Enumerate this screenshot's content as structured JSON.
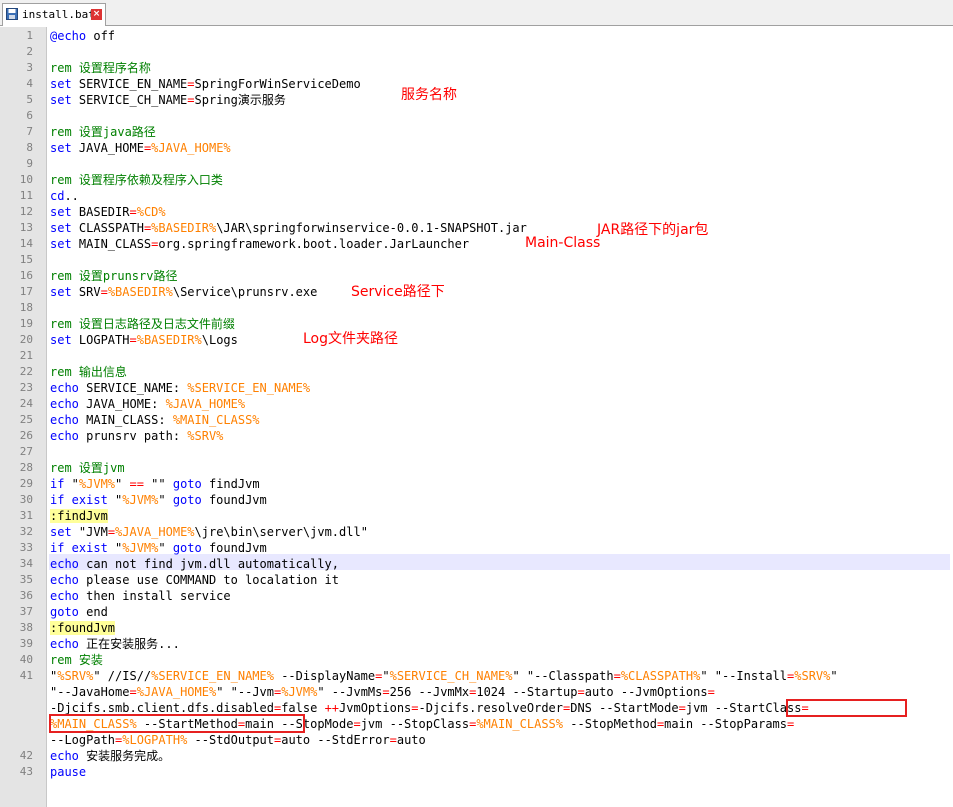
{
  "tab": {
    "filename": "install.bat",
    "close_glyph": "×"
  },
  "lines": [
    {
      "n": "1",
      "parts": [
        [
          "kw",
          "@echo"
        ],
        [
          "t",
          " off"
        ]
      ]
    },
    {
      "n": "2",
      "parts": []
    },
    {
      "n": "3",
      "parts": [
        [
          "cm",
          "rem 设置程序名称"
        ]
      ]
    },
    {
      "n": "4",
      "parts": [
        [
          "kw",
          "set"
        ],
        [
          "t",
          " SERVICE_EN_NAME"
        ],
        [
          "op",
          "="
        ],
        [
          "t",
          "SpringForWinServiceDemo"
        ]
      ]
    },
    {
      "n": "5",
      "parts": [
        [
          "kw",
          "set"
        ],
        [
          "t",
          " SERVICE_CH_NAME"
        ],
        [
          "op",
          "="
        ],
        [
          "t",
          "Spring演示服务"
        ]
      ]
    },
    {
      "n": "6",
      "parts": []
    },
    {
      "n": "7",
      "parts": [
        [
          "cm",
          "rem 设置java路径"
        ]
      ]
    },
    {
      "n": "8",
      "parts": [
        [
          "kw",
          "set"
        ],
        [
          "t",
          " JAVA_HOME"
        ],
        [
          "op",
          "="
        ],
        [
          "var",
          "%JAVA_HOME%"
        ]
      ]
    },
    {
      "n": "9",
      "parts": []
    },
    {
      "n": "10",
      "parts": [
        [
          "cm",
          "rem 设置程序依赖及程序入口类"
        ]
      ]
    },
    {
      "n": "11",
      "parts": [
        [
          "kw",
          "cd"
        ],
        [
          "t",
          ".."
        ]
      ]
    },
    {
      "n": "12",
      "parts": [
        [
          "kw",
          "set"
        ],
        [
          "t",
          " BASEDIR"
        ],
        [
          "op",
          "="
        ],
        [
          "var",
          "%CD%"
        ]
      ]
    },
    {
      "n": "13",
      "parts": [
        [
          "kw",
          "set"
        ],
        [
          "t",
          " CLASSPATH"
        ],
        [
          "op",
          "="
        ],
        [
          "var",
          "%BASEDIR%"
        ],
        [
          "t",
          "\\JAR\\springforwinservice-0.0.1-SNAPSHOT.jar"
        ]
      ]
    },
    {
      "n": "14",
      "parts": [
        [
          "kw",
          "set"
        ],
        [
          "t",
          " MAIN_CLASS"
        ],
        [
          "op",
          "="
        ],
        [
          "t",
          "org.springframework.boot.loader.JarLauncher"
        ]
      ]
    },
    {
      "n": "15",
      "parts": []
    },
    {
      "n": "16",
      "parts": [
        [
          "cm",
          "rem 设置prunsrv路径"
        ]
      ]
    },
    {
      "n": "17",
      "parts": [
        [
          "kw",
          "set"
        ],
        [
          "t",
          " SRV"
        ],
        [
          "op",
          "="
        ],
        [
          "var",
          "%BASEDIR%"
        ],
        [
          "t",
          "\\Service\\prunsrv.exe"
        ]
      ]
    },
    {
      "n": "18",
      "parts": []
    },
    {
      "n": "19",
      "parts": [
        [
          "cm",
          "rem 设置日志路径及日志文件前缀"
        ]
      ]
    },
    {
      "n": "20",
      "parts": [
        [
          "kw",
          "set"
        ],
        [
          "t",
          " LOGPATH"
        ],
        [
          "op",
          "="
        ],
        [
          "var",
          "%BASEDIR%"
        ],
        [
          "t",
          "\\Logs"
        ]
      ]
    },
    {
      "n": "21",
      "parts": []
    },
    {
      "n": "22",
      "parts": [
        [
          "cm",
          "rem 输出信息"
        ]
      ]
    },
    {
      "n": "23",
      "parts": [
        [
          "kw",
          "echo"
        ],
        [
          "t",
          " SERVICE_NAME: "
        ],
        [
          "var",
          "%SERVICE_EN_NAME%"
        ]
      ]
    },
    {
      "n": "24",
      "parts": [
        [
          "kw",
          "echo"
        ],
        [
          "t",
          " JAVA_HOME: "
        ],
        [
          "var",
          "%JAVA_HOME%"
        ]
      ]
    },
    {
      "n": "25",
      "parts": [
        [
          "kw",
          "echo"
        ],
        [
          "t",
          " MAIN_CLASS: "
        ],
        [
          "var",
          "%MAIN_CLASS%"
        ]
      ]
    },
    {
      "n": "26",
      "parts": [
        [
          "kw",
          "echo"
        ],
        [
          "t",
          " prunsrv path: "
        ],
        [
          "var",
          "%SRV%"
        ]
      ]
    },
    {
      "n": "27",
      "parts": []
    },
    {
      "n": "28",
      "parts": [
        [
          "cm",
          "rem 设置jvm"
        ]
      ]
    },
    {
      "n": "29",
      "parts": [
        [
          "kw",
          "if"
        ],
        [
          "t",
          " \""
        ],
        [
          "var",
          "%JVM%"
        ],
        [
          "t",
          "\" "
        ],
        [
          "op",
          "=="
        ],
        [
          "t",
          " \"\" "
        ],
        [
          "kw",
          "goto"
        ],
        [
          "t",
          " findJvm"
        ]
      ]
    },
    {
      "n": "30",
      "parts": [
        [
          "kw",
          "if exist"
        ],
        [
          "t",
          " \""
        ],
        [
          "var",
          "%JVM%"
        ],
        [
          "t",
          "\" "
        ],
        [
          "kw",
          "goto"
        ],
        [
          "t",
          " foundJvm"
        ]
      ]
    },
    {
      "n": "31",
      "parts": [
        [
          "lbl",
          ":findJvm"
        ]
      ]
    },
    {
      "n": "32",
      "parts": [
        [
          "kw",
          "set"
        ],
        [
          "t",
          " \"JVM"
        ],
        [
          "op",
          "="
        ],
        [
          "var",
          "%JAVA_HOME%"
        ],
        [
          "t",
          "\\jre\\bin\\server\\jvm.dll\""
        ]
      ]
    },
    {
      "n": "33",
      "parts": [
        [
          "kw",
          "if exist"
        ],
        [
          "t",
          " \""
        ],
        [
          "var",
          "%JVM%"
        ],
        [
          "t",
          "\" "
        ],
        [
          "kw",
          "goto"
        ],
        [
          "t",
          " foundJvm"
        ]
      ]
    },
    {
      "n": "34",
      "parts": [
        [
          "kw",
          "echo"
        ],
        [
          "t",
          " can not find jvm.dll automatically,"
        ]
      ]
    },
    {
      "n": "35",
      "parts": [
        [
          "kw",
          "echo"
        ],
        [
          "t",
          " please use COMMAND to localation it"
        ]
      ]
    },
    {
      "n": "36",
      "parts": [
        [
          "kw",
          "echo"
        ],
        [
          "t",
          " then install service"
        ]
      ]
    },
    {
      "n": "37",
      "parts": [
        [
          "kw",
          "goto"
        ],
        [
          "t",
          " end"
        ]
      ]
    },
    {
      "n": "38",
      "parts": [
        [
          "lbl",
          ":foundJvm"
        ]
      ]
    },
    {
      "n": "39",
      "parts": [
        [
          "kw",
          "echo"
        ],
        [
          "t",
          " 正在安装服务..."
        ]
      ]
    },
    {
      "n": "40",
      "parts": [
        [
          "cm",
          "rem 安装"
        ]
      ]
    },
    {
      "n": "41",
      "parts": [
        [
          "t",
          "\""
        ],
        [
          "var",
          "%SRV%"
        ],
        [
          "t",
          "\" //IS//"
        ],
        [
          "var",
          "%SERVICE_EN_NAME%"
        ],
        [
          "t",
          " --DisplayName"
        ],
        [
          "op",
          "="
        ],
        [
          "t",
          "\""
        ],
        [
          "var",
          "%SERVICE_CH_NAME%"
        ],
        [
          "t",
          "\" \"--Classpath"
        ],
        [
          "op",
          "="
        ],
        [
          "var",
          "%CLASSPATH%"
        ],
        [
          "t",
          "\" \"--Install"
        ],
        [
          "op",
          "="
        ],
        [
          "var",
          "%SRV%"
        ],
        [
          "t",
          "\""
        ]
      ]
    },
    {
      "n": "",
      "parts": [
        [
          "t",
          "\"--JavaHome"
        ],
        [
          "op",
          "="
        ],
        [
          "var",
          "%JAVA_HOME%"
        ],
        [
          "t",
          "\" \"--Jvm"
        ],
        [
          "op",
          "="
        ],
        [
          "var",
          "%JVM%"
        ],
        [
          "t",
          "\" --JvmMs"
        ],
        [
          "op",
          "="
        ],
        [
          "t",
          "256 --JvmMx"
        ],
        [
          "op",
          "="
        ],
        [
          "t",
          "1024 --Startup"
        ],
        [
          "op",
          "="
        ],
        [
          "t",
          "auto --JvmOptions"
        ],
        [
          "op",
          "="
        ]
      ]
    },
    {
      "n": "",
      "parts": [
        [
          "t",
          "-Djcifs.smb.client.dfs.disabled"
        ],
        [
          "op",
          "="
        ],
        [
          "t",
          "false "
        ],
        [
          "op",
          "++"
        ],
        [
          "t",
          "JvmOptions"
        ],
        [
          "op",
          "="
        ],
        [
          "t",
          "-Djcifs.resolveOrder"
        ],
        [
          "op",
          "="
        ],
        [
          "t",
          "DNS --StartMode"
        ],
        [
          "op",
          "="
        ],
        [
          "t",
          "jvm --StartClass"
        ],
        [
          "op",
          "="
        ]
      ]
    },
    {
      "n": "",
      "parts": [
        [
          "var",
          "%MAIN_CLASS%"
        ],
        [
          "t",
          " --StartMethod"
        ],
        [
          "op",
          "="
        ],
        [
          "t",
          "main --StopMode"
        ],
        [
          "op",
          "="
        ],
        [
          "t",
          "jvm --StopClass"
        ],
        [
          "op",
          "="
        ],
        [
          "var",
          "%MAIN_CLASS%"
        ],
        [
          "t",
          " --StopMethod"
        ],
        [
          "op",
          "="
        ],
        [
          "t",
          "main --StopParams"
        ],
        [
          "op",
          "="
        ]
      ]
    },
    {
      "n": "",
      "parts": [
        [
          "t",
          "--LogPath"
        ],
        [
          "op",
          "="
        ],
        [
          "var",
          "%LOGPATH%"
        ],
        [
          "t",
          " --StdOutput"
        ],
        [
          "op",
          "="
        ],
        [
          "t",
          "auto --StdError"
        ],
        [
          "op",
          "="
        ],
        [
          "t",
          "auto"
        ]
      ]
    },
    {
      "n": "42",
      "parts": [
        [
          "kw",
          "echo"
        ],
        [
          "t",
          " 安装服务完成。"
        ]
      ]
    },
    {
      "n": "43",
      "parts": [
        [
          "kw",
          "pause"
        ]
      ]
    }
  ],
  "annotations": {
    "service_name": "服务名称",
    "jar_path": "JAR路径下的jar包",
    "main_class": "Main-Class",
    "service_path": "Service路径下",
    "log_path": "Log文件夹路径"
  }
}
